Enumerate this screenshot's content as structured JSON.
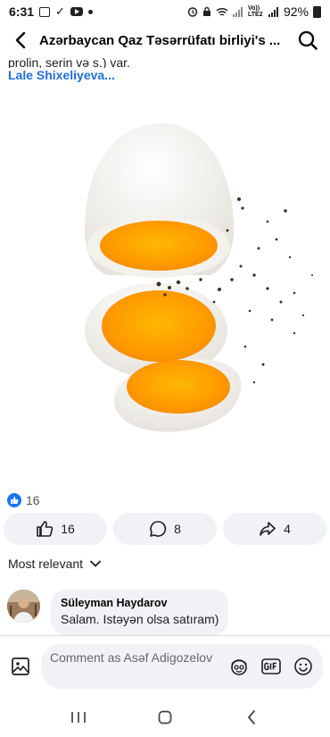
{
  "status_bar": {
    "time": "6:31",
    "network": "Vo)) LTE2",
    "battery": "92%"
  },
  "header": {
    "title": "Azərbaycan Qaz Təsərrüfatı birliyi's ..."
  },
  "post": {
    "text_tail": "prolin, serin və  s.) var.",
    "author": "Lale Shixeliyeva...",
    "image_icon": "boiled-egg-photo"
  },
  "reactions": {
    "count": "16"
  },
  "actions": {
    "like_count": "16",
    "comment_count": "8",
    "share_count": "4"
  },
  "comments": {
    "sort_label": "Most relevant",
    "items": [
      {
        "name": "Süleyman Haydarov",
        "text": "Salam. Istəyən olsa satıram)"
      }
    ]
  },
  "compose": {
    "placeholder": "Comment as Asəf Adigozelov"
  },
  "colors": {
    "accent": "#1877f2",
    "link": "#216fdb",
    "bubble": "#f0f2f5"
  }
}
